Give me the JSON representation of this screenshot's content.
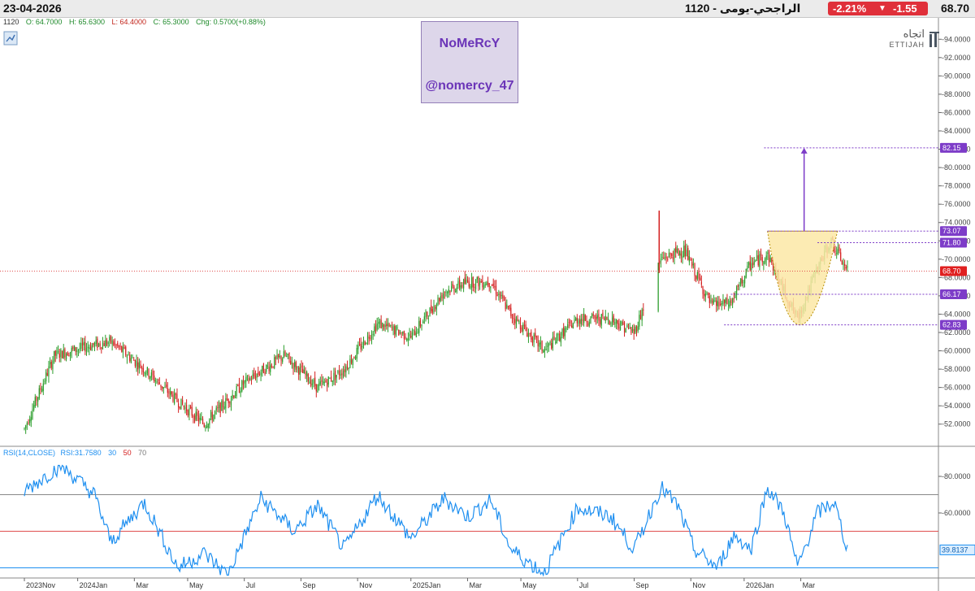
{
  "header": {
    "date": "23-04-2026",
    "title": "1120 - الراجحي-يومى",
    "change_percent": "-2.21%",
    "change_value": "-1.55",
    "last_price": "68.70"
  },
  "ohlc": {
    "symbol": "1120",
    "open": "O: 64.7000",
    "high": "H: 65.6300",
    "low": "L: 64.4000",
    "close": "C: 65.3000",
    "change": "Chg: 0.5700(+0.88%)"
  },
  "signature": {
    "name": "NoMeRcY",
    "handle": "@nomercy_47"
  },
  "logo": {
    "arabic": "اتجاه",
    "latin": "ETTIJAH"
  },
  "rsi_legend": {
    "title": "RSI(14,CLOSE)",
    "value": "RSI:31.7580",
    "l30": "30",
    "l50": "50",
    "l70": "70"
  },
  "colors": {
    "up": "#2a9d2a",
    "down": "#d42020",
    "rsi": "#1e8ff0",
    "pattern": "#7d3cc8",
    "pattern_fill": "#fbe8a6"
  },
  "chart_data": [
    {
      "type": "candlestick",
      "symbol": "1120",
      "ylim": [
        51,
        95
      ],
      "y_ticks": [
        "94.0000",
        "92.0000",
        "90.0000",
        "88.0000",
        "86.0000",
        "84.0000",
        "82.0000",
        "80.0000",
        "78.0000",
        "76.0000",
        "74.0000",
        "72.0000",
        "70.0000",
        "68.0000",
        "66.0000",
        "64.0000",
        "62.0000",
        "60.0000",
        "58.0000",
        "56.0000",
        "54.0000",
        "52.0000"
      ],
      "x_labels": [
        "2023Nov",
        "2024Jan",
        "Mar",
        "May",
        "Jul",
        "Sep",
        "Nov",
        "2025Jan",
        "Mar",
        "May",
        "Jul",
        "Sep",
        "Nov",
        "2026Jan",
        "Mar"
      ],
      "price_path": [
        [
          2023.84,
          51.5
        ],
        [
          2023.93,
          59.5
        ],
        [
          2024.03,
          60.5
        ],
        [
          2024.1,
          61.0
        ],
        [
          2024.2,
          58.0
        ],
        [
          2024.3,
          54.5
        ],
        [
          2024.38,
          52.0
        ],
        [
          2024.5,
          56.5
        ],
        [
          2024.62,
          59.5
        ],
        [
          2024.72,
          56.0
        ],
        [
          2024.8,
          58.0
        ],
        [
          2024.9,
          63.0
        ],
        [
          2025.0,
          61.5
        ],
        [
          2025.1,
          66.5
        ],
        [
          2025.17,
          67.5
        ],
        [
          2025.24,
          67.5
        ],
        [
          2025.3,
          64.0
        ],
        [
          2025.4,
          60.0
        ],
        [
          2025.5,
          63.5
        ],
        [
          2025.6,
          63.5
        ],
        [
          2025.67,
          62.0
        ],
        [
          2025.75,
          70.0
        ],
        [
          2025.82,
          71.0
        ],
        [
          2025.9,
          65.0
        ],
        [
          2025.96,
          65.2
        ],
        [
          2026.02,
          69.5
        ],
        [
          2026.07,
          70.5
        ],
        [
          2026.12,
          66.5
        ],
        [
          2026.16,
          63.5
        ],
        [
          2026.22,
          69.0
        ],
        [
          2026.26,
          72.0
        ],
        [
          2026.31,
          68.7
        ]
      ],
      "levels": [
        {
          "label": "82.15",
          "value": 82.15
        },
        {
          "label": "73.07",
          "value": 73.07
        },
        {
          "label": "71.80",
          "value": 71.8
        },
        {
          "label": "66.17",
          "value": 66.17
        },
        {
          "label": "62.83",
          "value": 62.83
        }
      ],
      "last": {
        "label": "68.70",
        "value": 68.7
      },
      "pattern": "cup (rounded bottom) from 73.07 down to 62.83 with breakout target arrow to 82.15"
    },
    {
      "type": "line",
      "title": "RSI(14,CLOSE)",
      "ylim": [
        20,
        92
      ],
      "y_ticks": [
        "80.0000",
        "60.0000"
      ],
      "levels": [
        30,
        50,
        70
      ],
      "last": {
        "label": "39.8137",
        "value": 39.8137
      },
      "rsi_path": [
        [
          2023.84,
          72
        ],
        [
          2023.95,
          86
        ],
        [
          2024.05,
          70
        ],
        [
          2024.1,
          44
        ],
        [
          2024.2,
          66
        ],
        [
          2024.3,
          30
        ],
        [
          2024.38,
          38
        ],
        [
          2024.45,
          26
        ],
        [
          2024.55,
          68
        ],
        [
          2024.65,
          50
        ],
        [
          2024.72,
          64
        ],
        [
          2024.8,
          40
        ],
        [
          2024.9,
          70
        ],
        [
          2025.0,
          46
        ],
        [
          2025.1,
          68
        ],
        [
          2025.17,
          58
        ],
        [
          2025.24,
          67
        ],
        [
          2025.3,
          40
        ],
        [
          2025.4,
          27
        ],
        [
          2025.5,
          63
        ],
        [
          2025.6,
          58
        ],
        [
          2025.67,
          40
        ],
        [
          2025.75,
          74
        ],
        [
          2025.8,
          64
        ],
        [
          2025.85,
          40
        ],
        [
          2025.92,
          30
        ],
        [
          2025.97,
          48
        ],
        [
          2026.02,
          40
        ],
        [
          2026.07,
          74
        ],
        [
          2026.12,
          60
        ],
        [
          2026.16,
          30
        ],
        [
          2026.22,
          60
        ],
        [
          2026.27,
          66
        ],
        [
          2026.31,
          40
        ]
      ]
    }
  ]
}
